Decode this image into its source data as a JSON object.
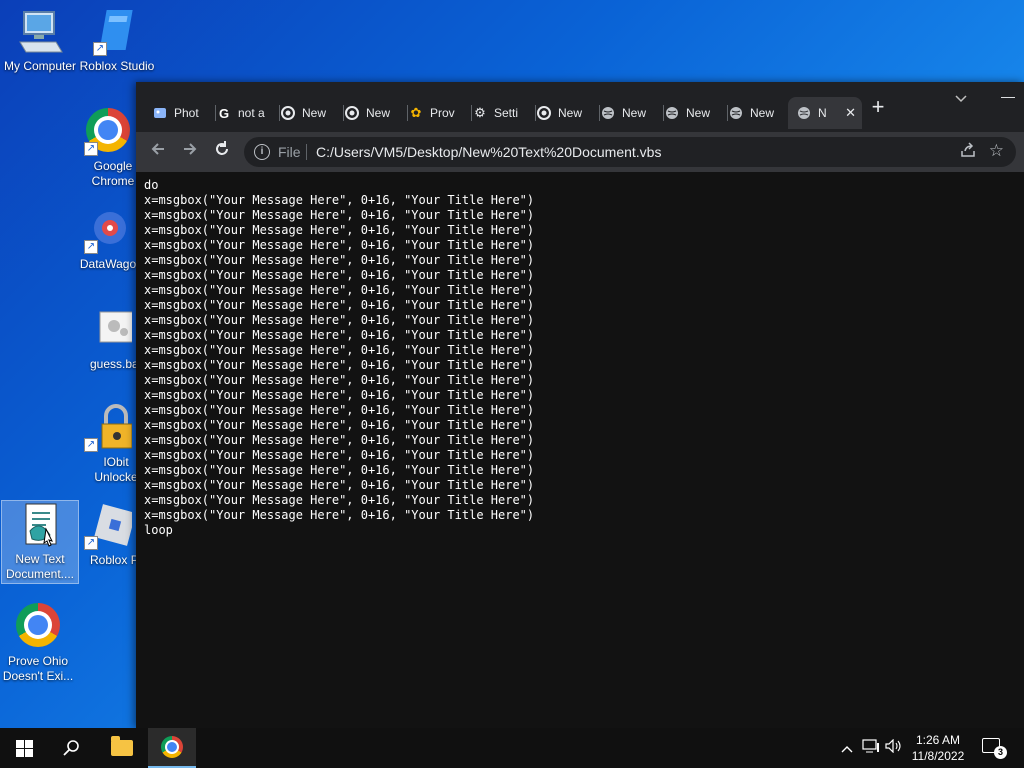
{
  "desktop": {
    "icons": [
      {
        "label": "My Computer",
        "icon": "computer-icon"
      },
      {
        "label": "Roblox Studio",
        "icon": "roblox-studio-icon"
      },
      {
        "label": "Google Chrome",
        "icon": "chrome-icon"
      },
      {
        "label": "DataWago",
        "icon": "datawago-icon"
      },
      {
        "label": "guess.ba",
        "icon": "batch-file-icon"
      },
      {
        "label": "IObit Unlocke",
        "icon": "iobit-unlocker-icon"
      },
      {
        "label": "New Text Document....",
        "icon": "vbs-script-icon"
      },
      {
        "label": "Roblox Pla",
        "icon": "roblox-player-icon"
      },
      {
        "label": "Prove Ohio Doesn't Exi...",
        "icon": "chrome-icon"
      }
    ]
  },
  "browser": {
    "tabs": [
      {
        "title": "Phot",
        "icon": "photos-icon"
      },
      {
        "title": "not a",
        "icon": "google-icon"
      },
      {
        "title": "New",
        "icon": "chrome-icon"
      },
      {
        "title": "New",
        "icon": "chrome-icon"
      },
      {
        "title": "Prov",
        "icon": "flower-icon"
      },
      {
        "title": "Setti",
        "icon": "gear-icon"
      },
      {
        "title": "New",
        "icon": "chrome-icon"
      },
      {
        "title": "New",
        "icon": "globe-icon"
      },
      {
        "title": "New",
        "icon": "globe-icon"
      },
      {
        "title": "New",
        "icon": "globe-icon"
      },
      {
        "title": "N",
        "icon": "globe-icon",
        "active": true
      }
    ],
    "toolbar": {
      "scheme_label": "File",
      "url": "C:/Users/VM5/Desktop/New%20Text%20Document.vbs"
    },
    "content": {
      "lines": [
        "do",
        "x=msgbox(\"Your Message Here\", 0+16, \"Your Title Here\")",
        "x=msgbox(\"Your Message Here\", 0+16, \"Your Title Here\")",
        "x=msgbox(\"Your Message Here\", 0+16, \"Your Title Here\")",
        "x=msgbox(\"Your Message Here\", 0+16, \"Your Title Here\")",
        "x=msgbox(\"Your Message Here\", 0+16, \"Your Title Here\")",
        "x=msgbox(\"Your Message Here\", 0+16, \"Your Title Here\")",
        "x=msgbox(\"Your Message Here\", 0+16, \"Your Title Here\")",
        "x=msgbox(\"Your Message Here\", 0+16, \"Your Title Here\")",
        "x=msgbox(\"Your Message Here\", 0+16, \"Your Title Here\")",
        "x=msgbox(\"Your Message Here\", 0+16, \"Your Title Here\")",
        "x=msgbox(\"Your Message Here\", 0+16, \"Your Title Here\")",
        "x=msgbox(\"Your Message Here\", 0+16, \"Your Title Here\")",
        "x=msgbox(\"Your Message Here\", 0+16, \"Your Title Here\")",
        "x=msgbox(\"Your Message Here\", 0+16, \"Your Title Here\")",
        "x=msgbox(\"Your Message Here\", 0+16, \"Your Title Here\")",
        "x=msgbox(\"Your Message Here\", 0+16, \"Your Title Here\")",
        "x=msgbox(\"Your Message Here\", 0+16, \"Your Title Here\")",
        "x=msgbox(\"Your Message Here\", 0+16, \"Your Title Here\")",
        "x=msgbox(\"Your Message Here\", 0+16, \"Your Title Here\")",
        "x=msgbox(\"Your Message Here\", 0+16, \"Your Title Here\")",
        "x=msgbox(\"Your Message Here\", 0+16, \"Your Title Here\")",
        "x=msgbox(\"Your Message Here\", 0+16, \"Your Title Here\")",
        "loop"
      ]
    }
  },
  "taskbar": {
    "time": "1:26 AM",
    "date": "11/8/2022",
    "notification_count": "3"
  },
  "colors": {
    "desktop_accent": "#0a63d6",
    "browser_bg": "#121212",
    "tabstrip": "#202124",
    "toolbar": "#35363a",
    "taskbar": "#101010"
  }
}
